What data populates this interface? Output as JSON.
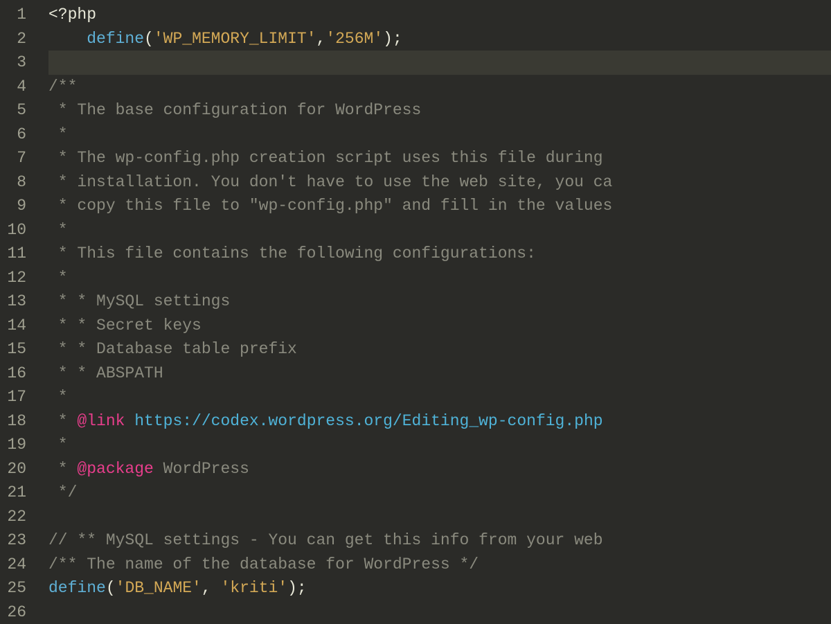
{
  "lines": {
    "count": 26
  },
  "code": {
    "l1": {
      "open": "<?php"
    },
    "l2": {
      "indent": "    ",
      "func": "define",
      "p1": "(",
      "s1": "'WP_MEMORY_LIMIT'",
      "c": ",",
      "s2": "'256M'",
      "p2": ");"
    },
    "l4": {
      "c": "/**"
    },
    "l5": {
      "c": " * The base configuration for WordPress"
    },
    "l6": {
      "c": " *"
    },
    "l7": {
      "c": " * The wp-config.php creation script uses this file during "
    },
    "l8": {
      "c": " * installation. You don't have to use the web site, you ca"
    },
    "l9": {
      "c": " * copy this file to \"wp-config.php\" and fill in the values"
    },
    "l10": {
      "c": " *"
    },
    "l11": {
      "c": " * This file contains the following configurations:"
    },
    "l12": {
      "c": " *"
    },
    "l13": {
      "c": " * * MySQL settings"
    },
    "l14": {
      "c": " * * Secret keys"
    },
    "l15": {
      "c": " * * Database table prefix"
    },
    "l16": {
      "c": " * * ABSPATH"
    },
    "l17": {
      "c": " *"
    },
    "l18": {
      "pre": " * ",
      "tag": "@link",
      "sp": " ",
      "link": "https://codex.wordpress.org/Editing_wp-config.php"
    },
    "l19": {
      "c": " *"
    },
    "l20": {
      "pre": " * ",
      "tag": "@package",
      "sp": " ",
      "text": "WordPress"
    },
    "l21": {
      "c": " */"
    },
    "l23": {
      "c": "// ** MySQL settings - You can get this info from your web "
    },
    "l24": {
      "c": "/** The name of the database for WordPress */"
    },
    "l25": {
      "func": "define",
      "p1": "(",
      "s1": "'DB_NAME'",
      "c": ", ",
      "s2": "'kriti'",
      "p2": ");"
    }
  }
}
